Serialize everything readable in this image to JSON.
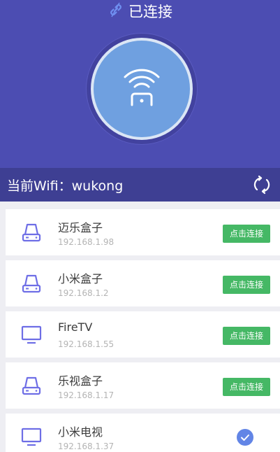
{
  "header": {
    "status_label": "已连接",
    "current_wifi": "当前Wifi：wukong"
  },
  "devices": [
    {
      "name": "迈乐盒子",
      "ip": "192.168.1.98",
      "type": "box",
      "action": "点击连接"
    },
    {
      "name": "小米盒子",
      "ip": "192.168.1.2",
      "type": "box",
      "action": "点击连接"
    },
    {
      "name": "FireTV",
      "ip": "192.168.1.55",
      "type": "tv",
      "action": "点击连接"
    },
    {
      "name": "乐视盒子",
      "ip": "192.168.1.17",
      "type": "box",
      "action": "点击连接"
    },
    {
      "name": "小米电视",
      "ip": "192.168.1.37",
      "type": "tv",
      "connected": true
    }
  ],
  "icons": {
    "status": "link-icon",
    "center": "wifi-remote-icon",
    "refresh": "refresh-icon",
    "box": "set-top-box-icon",
    "tv": "tv-icon",
    "connected": "check-circle-icon"
  },
  "colors": {
    "header_bg": "#4c4db2",
    "wifi_bar_bg": "#3e3f93",
    "accent": "#6e6ee6",
    "connect_green": "#45b865",
    "check_blue": "#6285e6"
  }
}
